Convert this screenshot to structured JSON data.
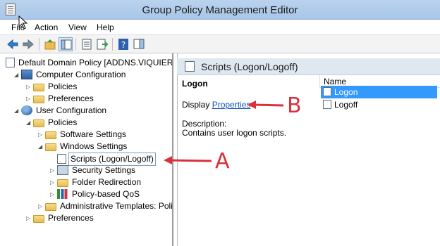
{
  "window": {
    "title": "Group Policy Management Editor"
  },
  "menu": [
    "File",
    "Action",
    "View",
    "Help"
  ],
  "toolbar": [
    "back-icon",
    "forward-icon",
    "up-folder-icon",
    "show-hide-tree-icon",
    "properties-icon",
    "export-list-icon",
    "help-icon",
    "show-action-pane-icon"
  ],
  "tree": [
    {
      "label": "Default Domain Policy [ADDNS.VIQUIERA.L",
      "icon": "policy-icon",
      "expander": ""
    },
    {
      "label": "Computer Configuration",
      "icon": "computer-icon",
      "expander": "◢"
    },
    {
      "label": "Policies",
      "icon": "folder-icon",
      "expander": "▷"
    },
    {
      "label": "Preferences",
      "icon": "folder-icon",
      "expander": "▷"
    },
    {
      "label": "User Configuration",
      "icon": "users-icon",
      "expander": "◢"
    },
    {
      "label": "Policies",
      "icon": "folder-icon",
      "expander": "◢"
    },
    {
      "label": "Software Settings",
      "icon": "folder-icon",
      "expander": "▷"
    },
    {
      "label": "Windows Settings",
      "icon": "folder-icon",
      "expander": "◢"
    },
    {
      "label": "Scripts (Logon/Logoff)",
      "icon": "scripts-icon",
      "expander": ""
    },
    {
      "label": "Security Settings",
      "icon": "security-icon",
      "expander": "▷"
    },
    {
      "label": "Folder Redirection",
      "icon": "folder-icon",
      "expander": "▷"
    },
    {
      "label": "Policy-based QoS",
      "icon": "chart-icon",
      "expander": "▷"
    },
    {
      "label": "Administrative Templates: Policy",
      "icon": "folder-icon",
      "expander": "▷"
    },
    {
      "label": "Preferences",
      "icon": "folder-icon",
      "expander": "▷"
    }
  ],
  "right": {
    "header": "Scripts (Logon/Logoff)",
    "heading": "Logon",
    "display_prefix": "Display",
    "display_link": "Properties",
    "description_label": "Description:",
    "description_text": "Contains user logon scripts.",
    "list_header": "Name",
    "list_items": [
      "Logon",
      "Logoff"
    ]
  },
  "annotations": {
    "a": "A",
    "b": "B",
    "color": "#d9303a"
  }
}
